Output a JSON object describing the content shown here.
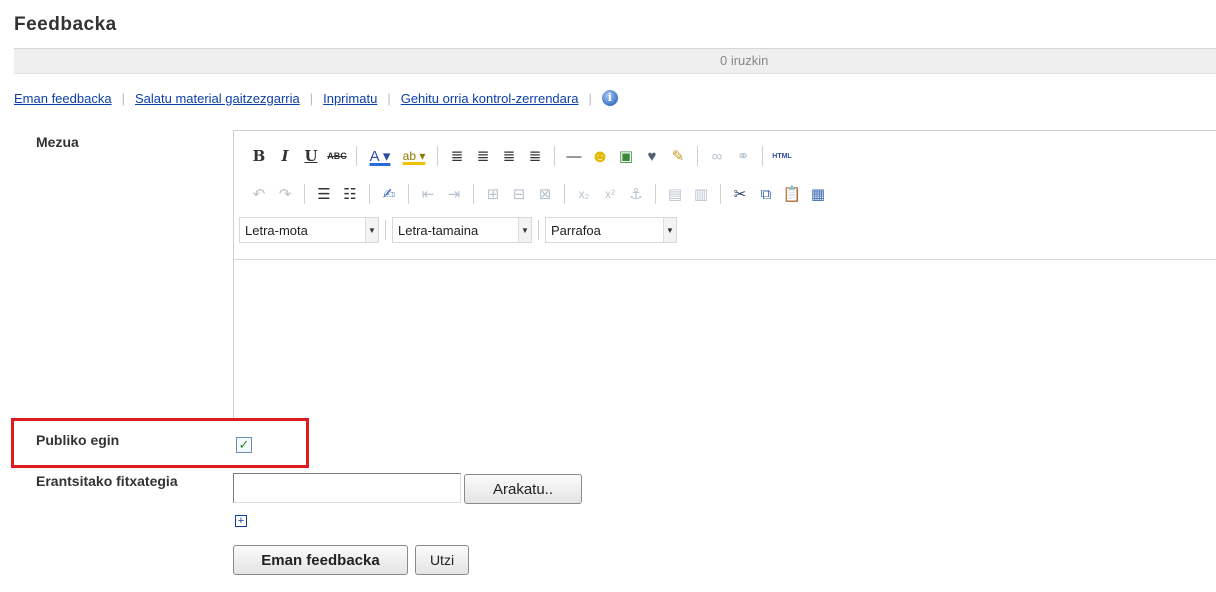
{
  "page": {
    "title": "Feedbacka",
    "comment_count": "0 iruzkin"
  },
  "actions": {
    "give_feedback": "Eman feedbacka",
    "report": "Salatu material gaitzezgarria",
    "print": "Inprimatu",
    "add_checklist": "Gehitu orria kontrol-zerrendara",
    "info_icon": "info-icon"
  },
  "form": {
    "message_label": "Mezua",
    "public_label": "Publiko egin",
    "public_checked": true,
    "attachment_label": "Erantsitako fitxategia",
    "attachment_value": "",
    "browse_button": "Arakatu..",
    "add_more": "[+]",
    "submit_button": "Eman feedbacka",
    "cancel_button": "Utzi"
  },
  "editor": {
    "font_select": "Letra-mota",
    "size_select": "Letra-tamaina",
    "format_select": "Parrafoa",
    "row1_icons": [
      "bold-icon",
      "italic-icon",
      "underline-icon",
      "strikethrough-icon",
      "font-color-icon",
      "highlight-icon",
      "align-left-icon",
      "align-center-icon",
      "align-right-icon",
      "justify-icon",
      "horizontal-rule-icon",
      "emoticon-icon",
      "image-icon",
      "clean-icon",
      "eraser-icon",
      "link-icon",
      "unlink-icon",
      "html-icon"
    ],
    "row2_icons": [
      "undo-icon",
      "redo-icon",
      "bullet-list-icon",
      "numbered-list-icon",
      "edit-icon",
      "outdent-icon",
      "indent-icon",
      "table-icon",
      "cell-icon",
      "row-icon",
      "subscript-icon",
      "superscript-icon",
      "anchor-icon",
      "select-all-icon",
      "source-icon",
      "cut-icon",
      "copy-icon",
      "paste-icon",
      "paste-word-icon"
    ],
    "html_label": "HTML"
  },
  "colors": {
    "link": "#0b3fa8",
    "highlight_border": "#e01b1b"
  }
}
